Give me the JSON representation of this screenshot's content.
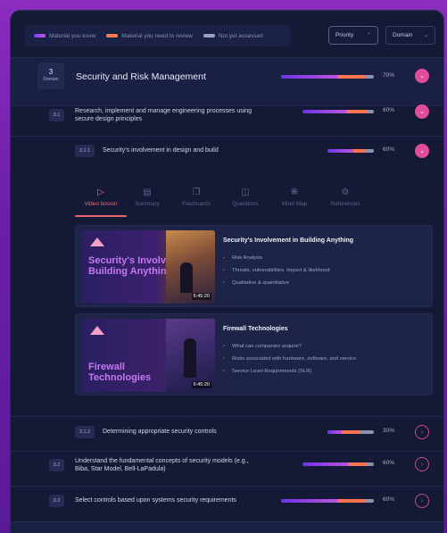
{
  "legend": {
    "items": [
      {
        "label": "Material you know",
        "color": "#7b3ff0"
      },
      {
        "label": "Material you need to review",
        "color": "#ff7a52"
      },
      {
        "label": "Not yet assessed",
        "color": "#9aa0bf"
      }
    ]
  },
  "filters": {
    "priority": "Priority",
    "domain": "Domain"
  },
  "domain": {
    "number": "3",
    "number_label": "Domain",
    "title": "Security and Risk Management",
    "progress": {
      "know": 0.62,
      "review": 0.28,
      "unassessed": 0.1
    },
    "percent": "70%"
  },
  "section_31": {
    "code": "3.1",
    "title_line1": "Research, implement and manage engineering processes using",
    "title_line2": "secure design principles",
    "progress": {
      "know": 0.62,
      "review": 0.28,
      "unassessed": 0.1
    },
    "percent": "60%"
  },
  "section_311": {
    "code": "3.1.1",
    "title": "Security's involvement in design and build",
    "progress": {
      "know": 0.55,
      "review": 0.25,
      "unassessed": 0.2
    },
    "percent": "60%"
  },
  "tabs": [
    {
      "label": "Video lesson",
      "icon": "play-icon"
    },
    {
      "label": "Summary",
      "icon": "document-icon"
    },
    {
      "label": "Flashcards",
      "icon": "flashcards-icon"
    },
    {
      "label": "Questions",
      "icon": "questions-icon"
    },
    {
      "label": "Mind Map",
      "icon": "mindmap-icon"
    },
    {
      "label": "References",
      "icon": "references-icon"
    }
  ],
  "videos": [
    {
      "thumb_title": "Security's Involvement in Building Anything",
      "duration": "6:45:20",
      "title": "Security's Involvement in Building Anything",
      "bullets": [
        "Risk Analysis",
        "Threats, vulnerabilities, impact & likelihood",
        "Qualitative & quantitative"
      ]
    },
    {
      "thumb_title": "Firewall Technologies",
      "duration": "6:45:20",
      "title": "Firewall Technologies",
      "bullets": [
        "What can companies acquire?",
        "Risks associated with hardware, software, and service",
        "Service Level Requirements (SLR)"
      ]
    }
  ],
  "section_312": {
    "code": "3.1.2",
    "title": "Determining appropriate security controls",
    "progress": {
      "know": 0.3,
      "review": 0.4,
      "unassessed": 0.3
    },
    "percent": "30%"
  },
  "section_32": {
    "code": "3.2",
    "title_line1": "Understand the fundamental concepts of security models (e.g.,",
    "title_line2": "Biba, Star Model, Bell-LaPadula)",
    "progress": {
      "know": 0.65,
      "review": 0.25,
      "unassessed": 0.1
    },
    "percent": "60%"
  },
  "section_33": {
    "code": "3.3",
    "title": "Select controls based upon systems security requirements",
    "progress": {
      "know": 0.62,
      "review": 0.28,
      "unassessed": 0.1
    },
    "percent": "60%"
  }
}
